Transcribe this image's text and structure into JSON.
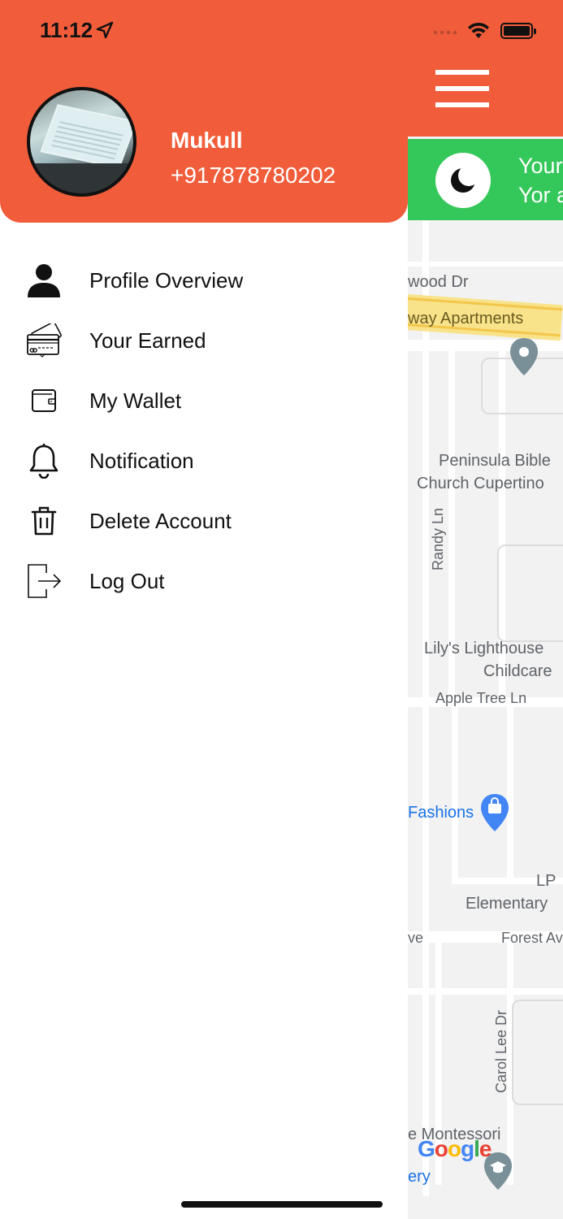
{
  "status_bar": {
    "time": "11:12"
  },
  "user": {
    "name": "Mukull",
    "phone": "+917878780202"
  },
  "menu": {
    "items": [
      {
        "label": "Profile Overview",
        "icon": "person-icon"
      },
      {
        "label": "Your Earned",
        "icon": "credit-card-icon"
      },
      {
        "label": "My Wallet",
        "icon": "wallet-icon"
      },
      {
        "label": "Notification",
        "icon": "bell-icon"
      },
      {
        "label": "Delete Account",
        "icon": "trash-icon"
      },
      {
        "label": "Log Out",
        "icon": "logout-icon"
      }
    ]
  },
  "banner": {
    "line1": "Your",
    "line2": "Yor a",
    "icon": "moon-icon"
  },
  "map": {
    "labels": {
      "street_wood": "wood Dr",
      "apartments": "way Apartments",
      "church_1": "Peninsula Bible",
      "church_2": "Church Cupertino",
      "randy": "Randy Ln",
      "lighthouse_1": "Lily's Lighthouse",
      "lighthouse_2": "Childcare",
      "apple_tree": "Apple Tree Ln",
      "fashions": "Fashions",
      "lp": "LP",
      "elementary": "Elementary",
      "ve": "ve",
      "forest": "Forest Av",
      "carol": "Carol Lee Dr",
      "montessori": "e Montessori",
      "ery": "ery",
      "google": "Google"
    }
  },
  "colors": {
    "header": "#f15d3b",
    "banner": "#34c759",
    "map_bg": "#f2f2f2"
  }
}
